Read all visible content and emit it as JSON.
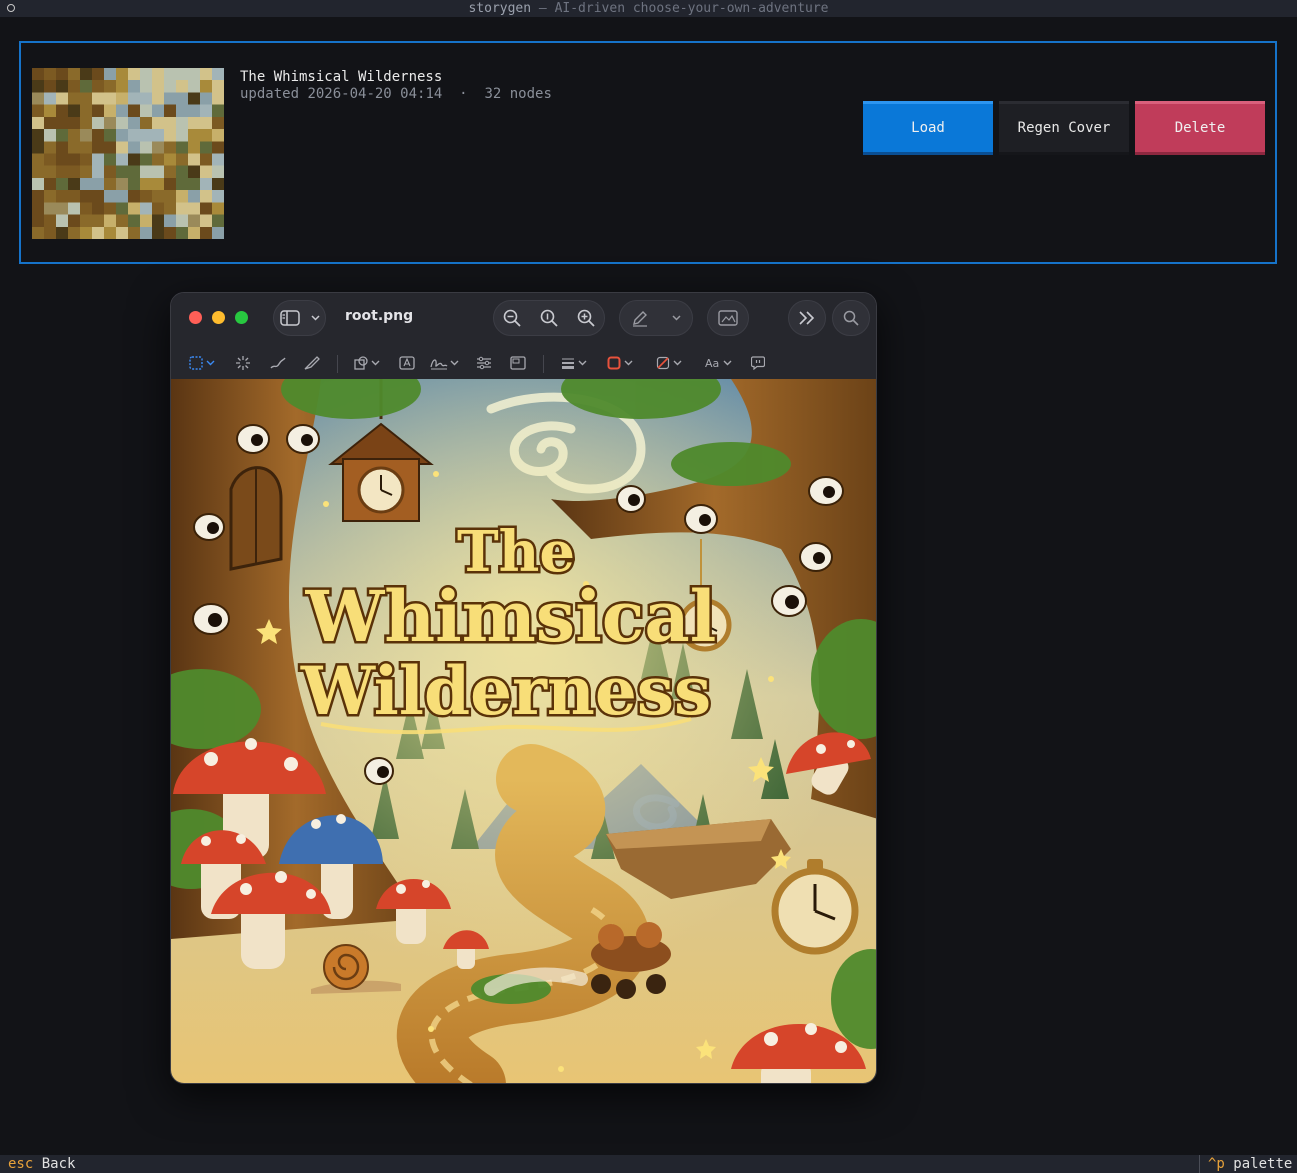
{
  "app": {
    "name": "storygen",
    "subtitle": "— AI-driven choose-your-own-adventure"
  },
  "story": {
    "title": "The Whimsical Wilderness",
    "updated_label": "updated",
    "updated_at": "2026-04-20 04:14",
    "separator": "·",
    "nodes": "32 nodes",
    "buttons": {
      "load": "Load",
      "regen_cover": "Regen Cover",
      "delete": "Delete"
    }
  },
  "preview": {
    "filename": "root.png",
    "cover_title_line1": "The",
    "cover_title_line2": "Whimsical",
    "cover_title_line3": "Wilderness"
  },
  "statusbar": {
    "back_key": "esc",
    "back_label": "Back",
    "palette_key": "^p",
    "palette_label": "palette"
  },
  "colors": {
    "accent": "#1673c9",
    "load": "#0a78d8",
    "delete": "#c03c5a",
    "key": "#e8a23a"
  }
}
